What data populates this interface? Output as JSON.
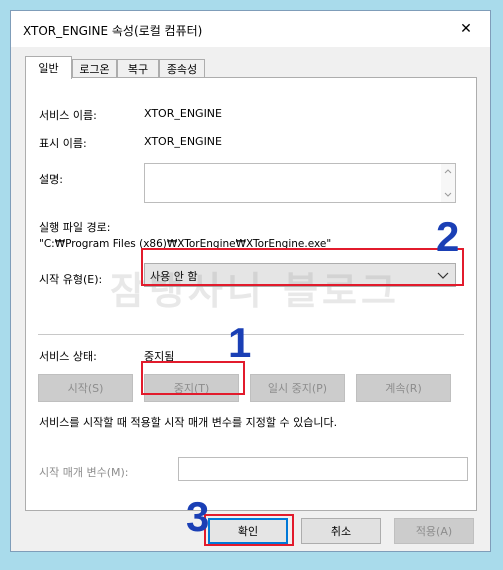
{
  "window": {
    "title": "XTOR_ENGINE 속성(로컬 컴퓨터)",
    "close_glyph": "✕"
  },
  "tabs": [
    {
      "label": "일반"
    },
    {
      "label": "로그온"
    },
    {
      "label": "복구"
    },
    {
      "label": "종속성"
    }
  ],
  "general": {
    "service_name_label": "서비스 이름:",
    "service_name_value": "XTOR_ENGINE",
    "display_name_label": "표시 이름:",
    "display_name_value": "XTOR_ENGINE",
    "description_label": "설명:",
    "description_value": "",
    "exe_path_label": "실행 파일 경로:",
    "exe_path_value": "\"C:₩Program Files (x86)₩XTorEngine₩XTorEngine.exe\"",
    "startup_type_label": "시작 유형(E):",
    "startup_type_value": "사용 안 함",
    "status_label": "서비스 상태:",
    "status_value": "중지됨",
    "start_button": "시작(S)",
    "stop_button": "중지(T)",
    "pause_button": "일시 중지(P)",
    "resume_button": "계속(R)",
    "params_help": "서비스를 시작할 때 적용할 시작 매개 변수를 지정할 수 있습니다.",
    "params_label": "시작 매개 변수(M):",
    "params_value": ""
  },
  "footer": {
    "ok_button": "확인",
    "cancel_button": "취소",
    "apply_button": "적용(A)"
  },
  "annotations": {
    "step1": "1",
    "step2": "2",
    "step3": "3",
    "watermark": "잠탱사니 블로그"
  },
  "colors": {
    "highlight_red": "#e21b2c",
    "annotation_blue": "#1a3fb5",
    "default_button_blue": "#0078d7",
    "background": "#a9dbeb"
  }
}
